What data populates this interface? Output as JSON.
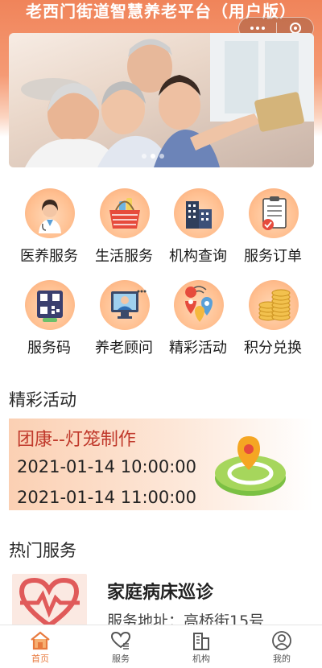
{
  "app": {
    "title": "老西门街道智慧养老平台（用户版）"
  },
  "capsule": {
    "more_icon": "more-dots-icon",
    "close_icon": "target-circle-icon"
  },
  "banner": {
    "slides": 3,
    "active_slide": 1
  },
  "quick_services": [
    {
      "label": "医养服务",
      "icon": "doctor-icon"
    },
    {
      "label": "生活服务",
      "icon": "shopping-basket-icon"
    },
    {
      "label": "机构查询",
      "icon": "building-icon"
    },
    {
      "label": "服务订单",
      "icon": "clipboard-check-icon"
    },
    {
      "label": "服务码",
      "icon": "qr-code-icon"
    },
    {
      "label": "养老顾问",
      "icon": "consultant-icon"
    },
    {
      "label": "精彩活动",
      "icon": "map-pins-icon"
    },
    {
      "label": "积分兑换",
      "icon": "coins-icon"
    }
  ],
  "activities": {
    "heading": "精彩活动",
    "items": [
      {
        "title": "团康--灯笼制作",
        "start": "2021-01-14 10:00:00",
        "end": "2021-01-14 11:00:00"
      }
    ]
  },
  "hot_services": {
    "heading": "热门服务",
    "items": [
      {
        "name": "家庭病床巡诊",
        "address": "服务地址：高桥街15号"
      }
    ]
  },
  "tabbar": [
    {
      "label": "首页",
      "icon": "home-icon",
      "active": true
    },
    {
      "label": "服务",
      "icon": "heart-hand-icon",
      "active": false
    },
    {
      "label": "机构",
      "icon": "building-icon",
      "active": false
    },
    {
      "label": "我的",
      "icon": "user-icon",
      "active": false
    }
  ],
  "colors": {
    "accent": "#e87a3e",
    "header": "#f0845a",
    "activity_title": "#c0392b"
  }
}
